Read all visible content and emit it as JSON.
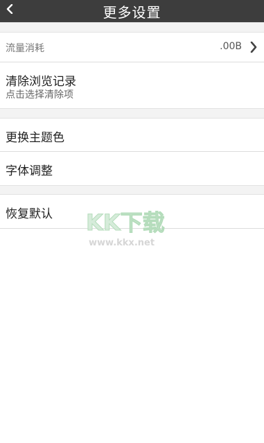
{
  "header": {
    "title": "更多设置",
    "back_icon": "chevron-left-icon"
  },
  "traffic": {
    "label": "流量消耗",
    "value": ".00B",
    "arrow_icon": "chevron-right-icon"
  },
  "clear_history": {
    "label": "清除浏览记录",
    "sublabel": "点击选择清除项"
  },
  "theme": {
    "label": "更换主题色"
  },
  "font": {
    "label": "字体调整"
  },
  "reset": {
    "label": "恢复默认"
  },
  "watermark": {
    "logo": "KK下载",
    "url": "www.kkx.net"
  },
  "colors": {
    "titlebar": "#3d3d3d",
    "section_gap": "#f3f3f3",
    "divider": "#dcdcdc"
  }
}
